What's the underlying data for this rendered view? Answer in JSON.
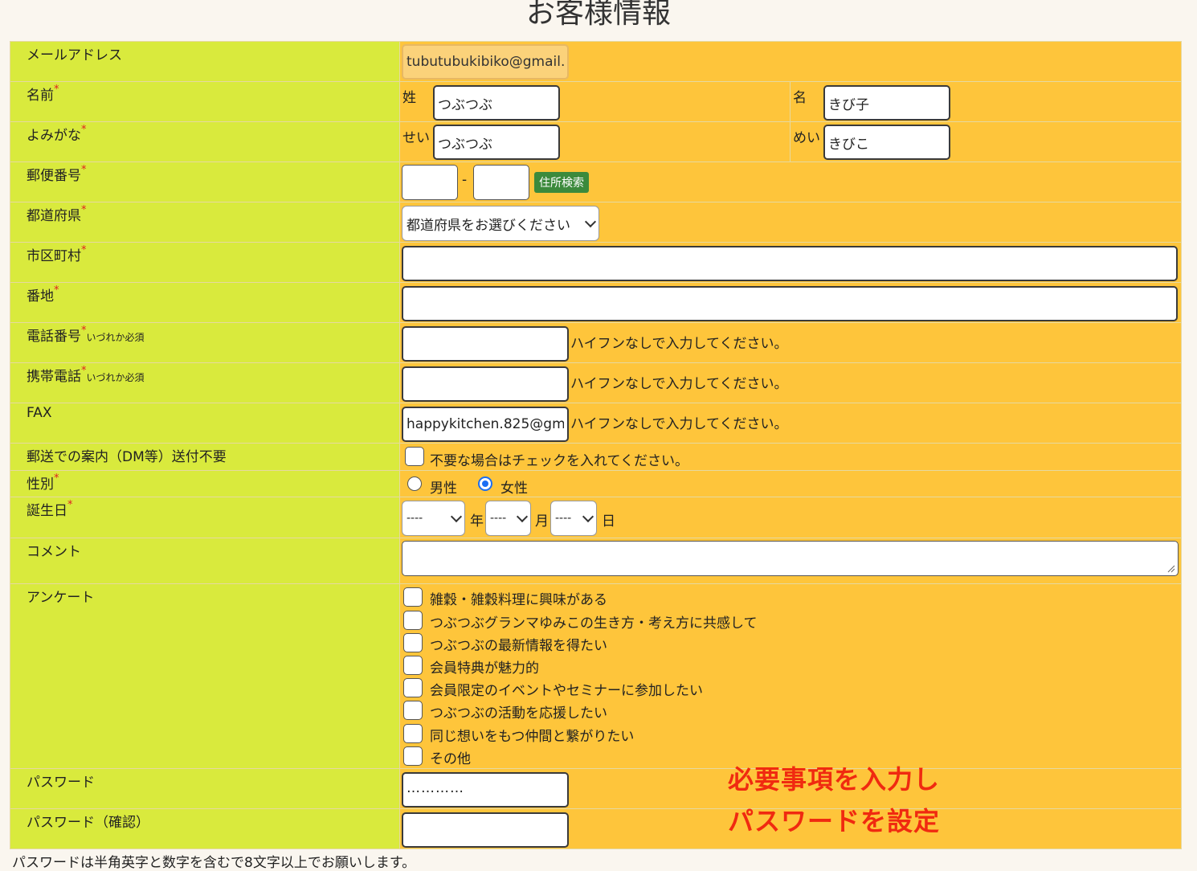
{
  "page_title": "お客様情報",
  "required_mark": "*",
  "email": {
    "label": "メールアドレス",
    "value": "tubutubukibiko@gmail."
  },
  "name": {
    "label": "名前",
    "last_label": "姓",
    "last_value": "つぶつぶ",
    "first_label": "名",
    "first_value": "きび子"
  },
  "kana": {
    "label": "よみがな",
    "last_label": "せい",
    "last_value": "つぶつぶ",
    "first_label": "めい",
    "first_value": "きびこ"
  },
  "zip": {
    "label": "郵便番号",
    "first_value": "",
    "separator": "-",
    "second_value": "",
    "search_button": "住所検索"
  },
  "prefecture": {
    "label": "都道府県",
    "selected": "都道府県をお選びください"
  },
  "city": {
    "label": "市区町村",
    "value": ""
  },
  "street": {
    "label": "番地",
    "value": ""
  },
  "phone": {
    "label": "電話番号",
    "note": "いづれか必須",
    "value": "",
    "hint": "ハイフンなしで入力してください。"
  },
  "mobile": {
    "label": "携帯電話",
    "note": "いづれか必須",
    "value": "",
    "hint": "ハイフンなしで入力してください。"
  },
  "fax": {
    "label": "FAX",
    "value": "happykitchen.825@gm",
    "hint": "ハイフンなしで入力してください。"
  },
  "dm": {
    "label": "郵送での案内（DM等）送付不要",
    "checkbox_label": "不要な場合はチェックを入れてください。",
    "checked": false
  },
  "gender": {
    "label": "性別",
    "options": [
      "男性",
      "女性"
    ],
    "selected": "女性"
  },
  "birthday": {
    "label": "誕生日",
    "year": "----",
    "year_unit": "年",
    "month": "----",
    "month_unit": "月",
    "day": "----",
    "day_unit": "日"
  },
  "comment": {
    "label": "コメント",
    "value": ""
  },
  "survey": {
    "label": "アンケート",
    "items": [
      "雑穀・雑穀料理に興味がある",
      "つぶつぶグランマゆみこの生き方・考え方に共感して",
      "つぶつぶの最新情報を得たい",
      "会員特典が魅力的",
      "会員限定のイベントやセミナーに参加したい",
      "つぶつぶの活動を応援したい",
      "同じ想いをもつ仲間と繋がりたい",
      "その他"
    ]
  },
  "password": {
    "label": "パスワード",
    "value": "…………"
  },
  "password_confirm": {
    "label": "パスワード（確認）",
    "value": ""
  },
  "annotation": {
    "line1": "必要事項を入力し",
    "line2": "パスワードを設定"
  },
  "footnote": "パスワードは半角英字と数字を含むで8文字以上でお願いします。",
  "colors": {
    "label_bg": "#d9ea3d",
    "value_bg": "#fec53b",
    "required": "#e02020",
    "search_button": "#3c8a3c",
    "annotation": "#f02a10"
  }
}
